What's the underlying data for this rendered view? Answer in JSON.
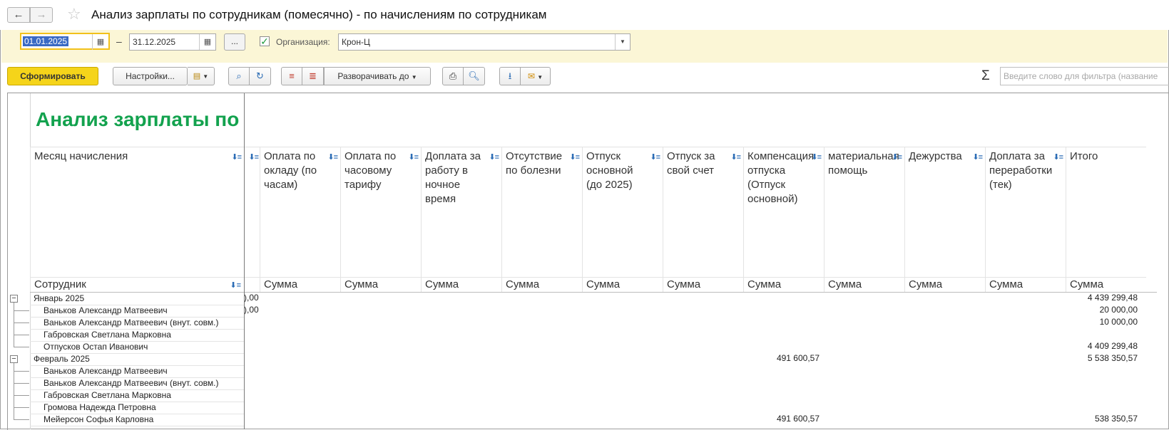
{
  "window": {
    "title": "Анализ зарплаты по сотрудникам (помесячно) - по начислениям по сотрудникам",
    "back_icon": "arrow-left",
    "forward_icon": "arrow-right",
    "favorite_icon": "star"
  },
  "filters": {
    "date_from": "01.01.2025",
    "date_separator": "–",
    "date_to": "31.12.2025",
    "period_button": "...",
    "org_label": "Организация:",
    "org_value": "Крон-Ц",
    "org_checked": true
  },
  "toolbar": {
    "generate": "Сформировать",
    "settings": "Настройки...",
    "expand": "Разворачивать до",
    "sigma": "Σ",
    "search_placeholder": "Введите слово для фильтра (название"
  },
  "report": {
    "title": "Анализ зарплаты по сотрудникам (помесячно) - по начислениям по сотрудникам",
    "row_header_top": "Месяц начисления",
    "row_header_bottom": "Сотрудник",
    "columns": [
      {
        "label": "Оплата по окладу (по часам)",
        "sub": "Сумма"
      },
      {
        "label": "Оплата по часовому тарифу",
        "sub": "Сумма"
      },
      {
        "label": "Доплата за работу в ночное время",
        "sub": "Сумма"
      },
      {
        "label": "Отсутствие по болезни",
        "sub": "Сумма"
      },
      {
        "label": "Отпуск основной (до 2025)",
        "sub": "Сумма"
      },
      {
        "label": "Отпуск за свой счет",
        "sub": "Сумма"
      },
      {
        "label": "Компенсация отпуска (Отпуск основной)",
        "sub": "Сумма"
      },
      {
        "label": "материальная помощь",
        "sub": "Сумма"
      },
      {
        "label": "Дежурства",
        "sub": "Сумма"
      },
      {
        "label": "Доплата за переработки (тек)",
        "sub": "Сумма"
      },
      {
        "label": "Итого",
        "sub": "Сумма"
      }
    ],
    "rows": [
      {
        "name": "Январь 2025",
        "level": 0,
        "frag": "),00",
        "comp": "",
        "total": "4 439 299,48"
      },
      {
        "name": "Ваньков Александр Матвеевич",
        "level": 1,
        "frag": "),00",
        "comp": "",
        "total": "20 000,00"
      },
      {
        "name": "Ваньков Александр Матвеевич (внут. совм.)",
        "level": 1,
        "frag": "",
        "comp": "",
        "total": "10 000,00"
      },
      {
        "name": "Габровская Светлана Марковна",
        "level": 1,
        "frag": "",
        "comp": "",
        "total": ""
      },
      {
        "name": "Отпусков Остап Иванович",
        "level": 1,
        "frag": "",
        "comp": "",
        "total": "4 409 299,48"
      },
      {
        "name": "Февраль 2025",
        "level": 0,
        "frag": "",
        "comp": "491 600,57",
        "total": "5 538 350,57"
      },
      {
        "name": "Ваньков Александр Матвеевич",
        "level": 1,
        "frag": "",
        "comp": "",
        "total": ""
      },
      {
        "name": "Ваньков Александр Матвеевич (внут. совм.)",
        "level": 1,
        "frag": "",
        "comp": "",
        "total": ""
      },
      {
        "name": "Габровская Светлана Марковна",
        "level": 1,
        "frag": "",
        "comp": "",
        "total": ""
      },
      {
        "name": "Громова Надежда Петровна",
        "level": 1,
        "frag": "",
        "comp": "",
        "total": ""
      },
      {
        "name": "Мейерсон Софья Карловна",
        "level": 1,
        "frag": "",
        "comp": "491 600,57",
        "total": "538 350,57"
      }
    ]
  }
}
